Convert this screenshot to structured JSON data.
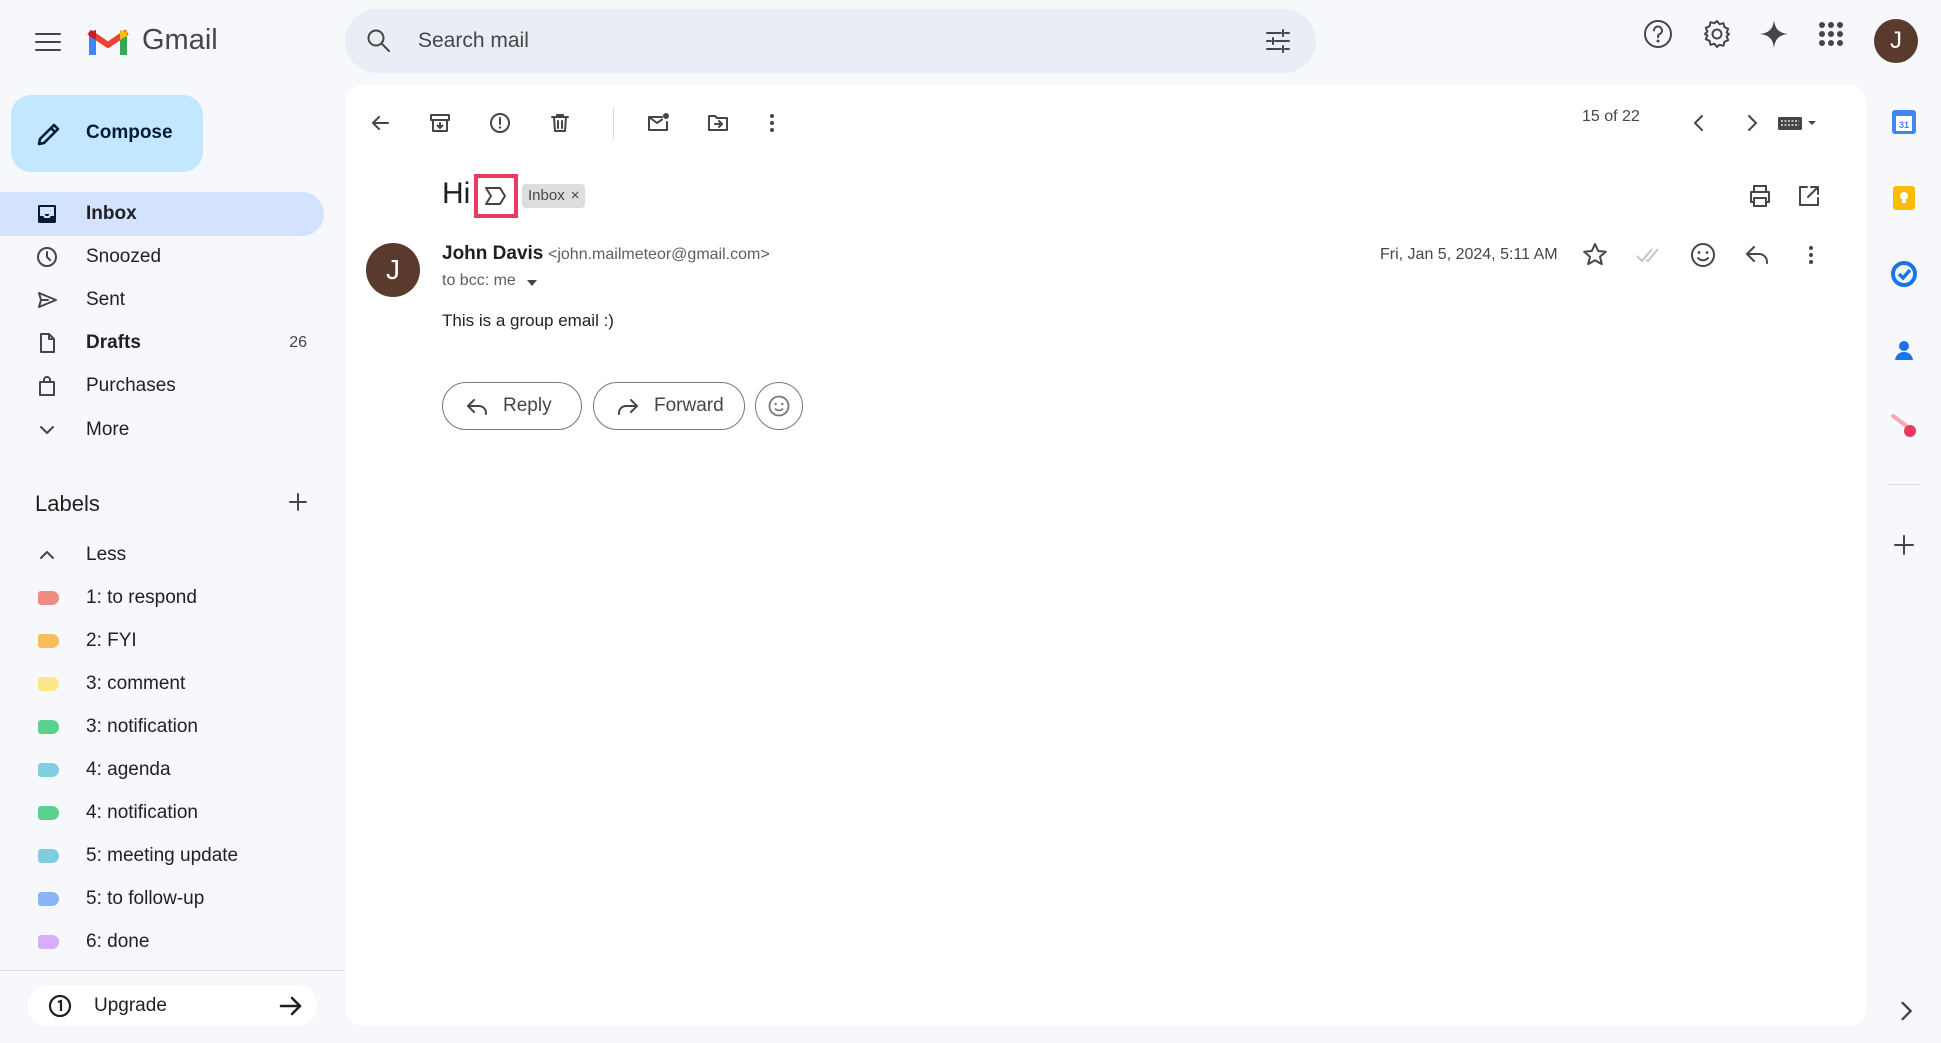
{
  "app": {
    "name": "Gmail"
  },
  "search": {
    "placeholder": "Search mail"
  },
  "compose": {
    "label": "Compose"
  },
  "nav": [
    {
      "label": "Inbox",
      "count": "",
      "active": true,
      "bold": true
    },
    {
      "label": "Snoozed",
      "count": ""
    },
    {
      "label": "Sent",
      "count": ""
    },
    {
      "label": "Drafts",
      "count": "26",
      "bold": true
    },
    {
      "label": "Purchases",
      "count": ""
    },
    {
      "label": "More",
      "count": ""
    }
  ],
  "labels": {
    "title": "Labels",
    "toggle": "Less",
    "items": [
      {
        "label": "1: to respond",
        "color": "#f28b82"
      },
      {
        "label": "2: FYI",
        "color": "#fbbc5a"
      },
      {
        "label": "3: comment",
        "color": "#fde68a"
      },
      {
        "label": "3: notification",
        "color": "#5ad18e"
      },
      {
        "label": "4: agenda",
        "color": "#7fcfe0"
      },
      {
        "label": "4: notification",
        "color": "#5ad18e"
      },
      {
        "label": "5: meeting update",
        "color": "#7fcfe0"
      },
      {
        "label": "5: to follow-up",
        "color": "#8ab4f8"
      },
      {
        "label": "6: done",
        "color": "#d7aefb"
      }
    ]
  },
  "upgrade": {
    "label": "Upgrade"
  },
  "toolbar": {
    "pager": "15 of 22"
  },
  "email": {
    "subject": "Hi",
    "chip": "Inbox",
    "sender_name": "John Davis",
    "sender_email": "<john.mailmeteor@gmail.com>",
    "recipients": "to bcc: me",
    "date": "Fri, Jan 5, 2024, 5:11 AM",
    "body": "This is a group email :)",
    "avatar_letter": "J"
  },
  "actions": {
    "reply": "Reply",
    "forward": "Forward"
  },
  "account": {
    "avatar_letter": "J"
  },
  "colors": {
    "accent": "#c2e7ff",
    "active_nav": "#d3e3fd",
    "highlight": "#e8395f",
    "avatar": "#5b3a2e"
  }
}
